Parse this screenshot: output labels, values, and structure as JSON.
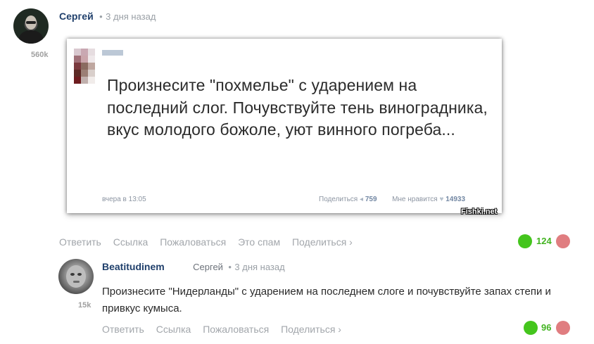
{
  "comments": [
    {
      "author": "Сергей",
      "time": "3 дня назад",
      "user_rating": "560k",
      "image": {
        "quote": "Произнесите \"похмелье\" с ударением на последний слог. Почувствуйте тень виноградника, вкус молодого божоле, уют винного погреба...",
        "date": "вчера в 13:05",
        "share_label": "Поделиться",
        "share_count": "759",
        "likes_label": "Мне нравится",
        "likes_count": "14933",
        "watermark": "Fishki.net"
      },
      "actions": [
        "Ответить",
        "Ссылка",
        "Пожаловаться",
        "Это спам",
        "Поделиться ›"
      ],
      "score": "124"
    },
    {
      "author": "Beatitudinem",
      "reply_to": "Сергей",
      "time": "3 дня назад",
      "user_rating": "15k",
      "text": "Произнесите \"Нидерланды\" с ударением на последнем слоге и почувствуйте запах степи и привкус кумыса.",
      "actions": [
        "Ответить",
        "Ссылка",
        "Пожаловаться",
        "Поделиться ›"
      ],
      "score": "96"
    }
  ],
  "separator": "•",
  "colors": {
    "username": "#1f3f6b",
    "vote_up": "#44c51d",
    "vote_down": "#e07d80",
    "score": "#44b423"
  }
}
